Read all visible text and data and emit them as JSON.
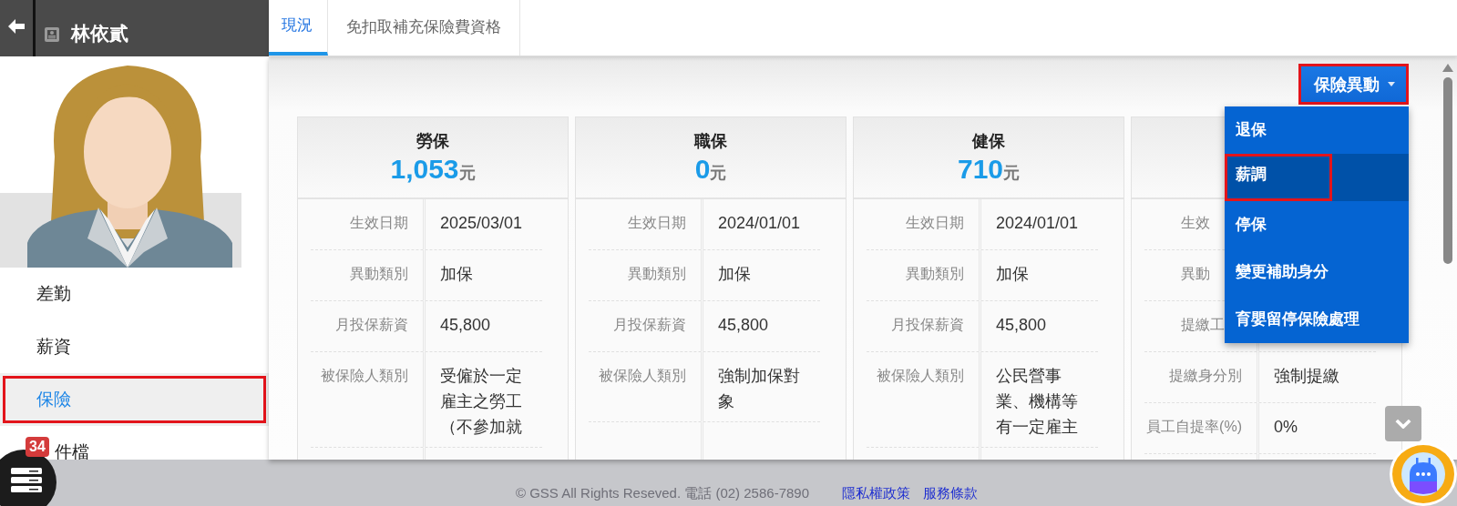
{
  "header": {
    "name": "林依貳"
  },
  "tabs": [
    {
      "label": "現況",
      "selected": true
    },
    {
      "label": "免扣取補充保險費資格",
      "selected": false
    }
  ],
  "nav": [
    {
      "label": "差勤",
      "selected": false,
      "outlined": false
    },
    {
      "label": "薪資",
      "selected": false,
      "outlined": false
    },
    {
      "label": "保險",
      "selected": true,
      "outlined": true
    },
    {
      "label": "件檔",
      "selected": false,
      "outlined": false,
      "covered": true
    }
  ],
  "notification_badge": "34",
  "action_button": {
    "label": "保險異動",
    "outlined": true
  },
  "action_menu": [
    {
      "label": "退保",
      "selected": false,
      "outlined": false
    },
    {
      "label": "薪調",
      "selected": true,
      "outlined": true
    },
    {
      "label": "停保",
      "selected": false,
      "outlined": false
    },
    {
      "label": "變更補助身分",
      "selected": false,
      "outlined": false
    },
    {
      "label": "育嬰留停保險處理",
      "selected": false,
      "outlined": false
    }
  ],
  "cards": [
    {
      "title": "勞保",
      "amount": "1,053",
      "unit": "元",
      "rows": [
        {
          "label": "生效日期",
          "value": "2025/03/01"
        },
        {
          "label": "異動類別",
          "value": "加保"
        },
        {
          "label": "月投保薪資",
          "value": "45,800"
        },
        {
          "label": "被保險人類別",
          "value": "受僱於一定雇主之勞工（不參加就"
        }
      ]
    },
    {
      "title": "職保",
      "amount": "0",
      "unit": "元",
      "rows": [
        {
          "label": "生效日期",
          "value": "2024/01/01"
        },
        {
          "label": "異動類別",
          "value": "加保"
        },
        {
          "label": "月投保薪資",
          "value": "45,800"
        },
        {
          "label": "被保險人類別",
          "value": "強制加保對象"
        }
      ]
    },
    {
      "title": "健保",
      "amount": "710",
      "unit": "元",
      "rows": [
        {
          "label": "生效日期",
          "value": "2024/01/01"
        },
        {
          "label": "異動類別",
          "value": "加保"
        },
        {
          "label": "月投保薪資",
          "value": "45,800"
        },
        {
          "label": "被保險人類別",
          "value": "公民營事業、機構等有一定雇主"
        }
      ]
    },
    {
      "rows": [
        {
          "label": "生效",
          "covered": true
        },
        {
          "label": "異動",
          "covered": true
        },
        {
          "label": "提繳工",
          "covered": true
        },
        {
          "label": "提繳身分別",
          "value": "強制提繳"
        },
        {
          "label": "員工自提率(%)",
          "value": "0%"
        }
      ]
    }
  ],
  "footer": {
    "copyright": "© GSS All Rights Reseved. 電話 (02) 2586-7890",
    "links": [
      "隱私權政策",
      "服務條款"
    ]
  }
}
